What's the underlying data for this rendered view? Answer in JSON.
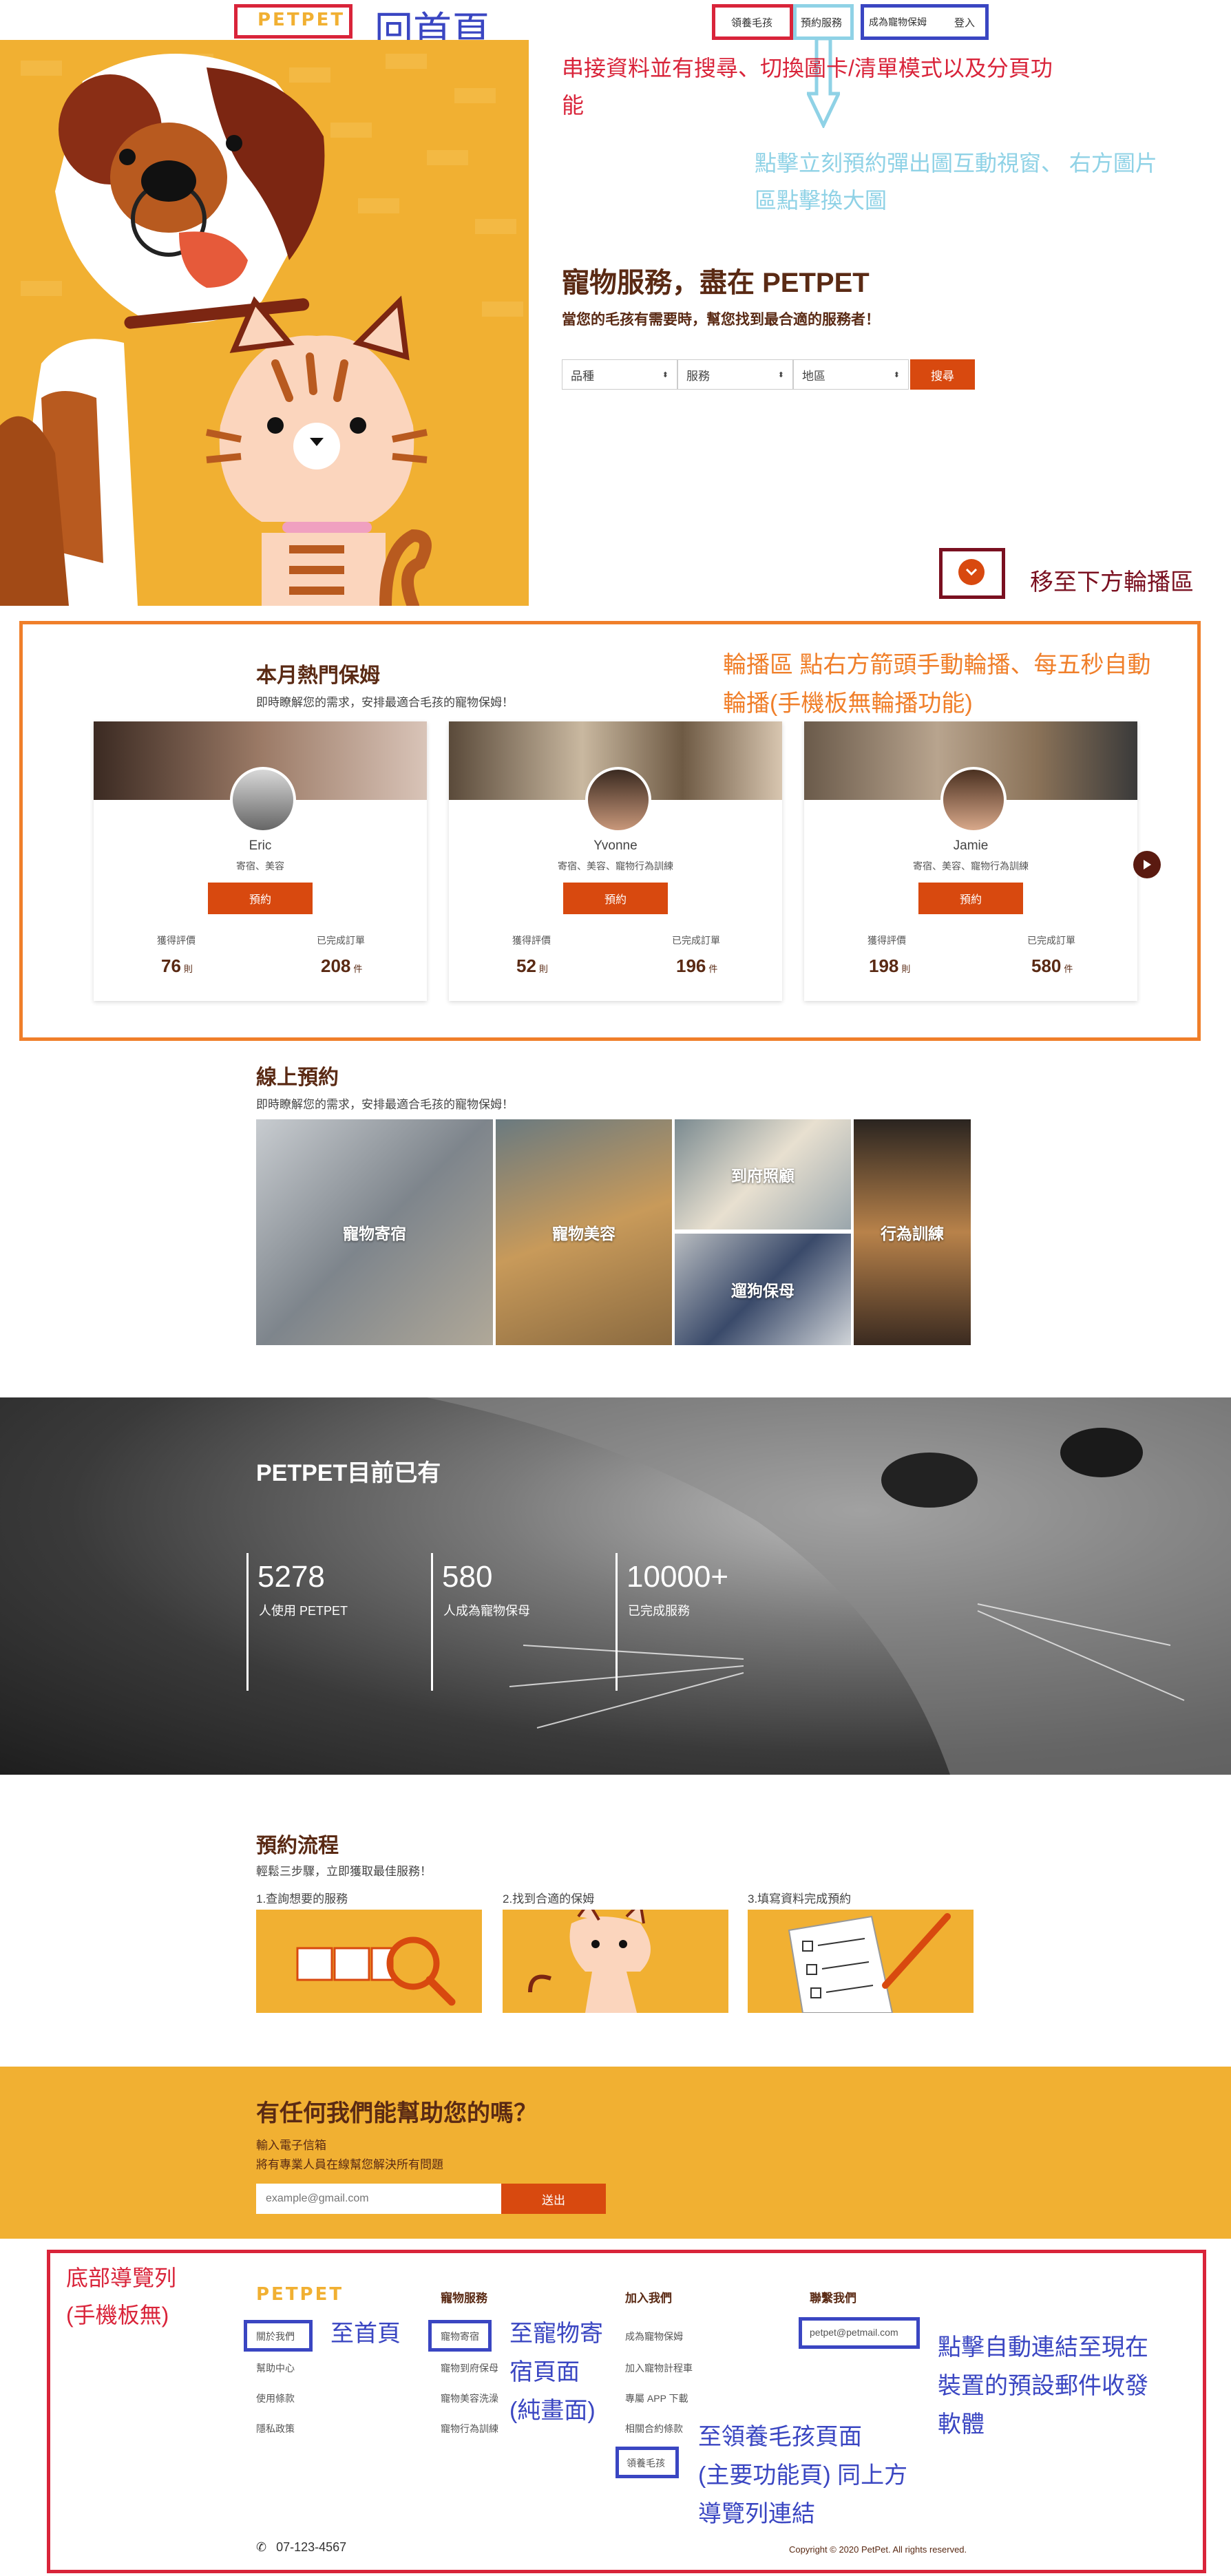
{
  "header": {
    "logo": "PETPET",
    "nav": [
      "領養毛孩",
      "預約服務",
      "成為寵物保姆",
      "登入"
    ]
  },
  "annotations": {
    "home": "回首頁",
    "search_feature": [
      "串接資料並有搜尋、切換圖卡/清單模式以及分頁功",
      "能"
    ],
    "booking_popup": [
      "點擊立刻預約彈出圖互動視窗、 右方圖片",
      "區點擊換大圖"
    ],
    "scroll_down": "移至下方輪播區",
    "carousel": [
      "輪播區 點右方箭頭手動輪播、每五秒自動",
      "輪播(手機板無輪播功能)"
    ],
    "footer_nav": [
      "底部導覽列",
      "(手機板無)"
    ],
    "to_home": "至首頁",
    "to_boarding": [
      "至寵物寄",
      "宿頁面",
      "(純畫面)"
    ],
    "to_adopt": [
      "至領養毛孩頁面",
      "(主要功能頁) 同上方",
      "導覽列連結"
    ],
    "email_auto": [
      "點擊自動連結至現在",
      "裝置的預設郵件收發",
      "軟體"
    ]
  },
  "hero": {
    "title": "寵物服務，盡在 PETPET",
    "subtitle": "當您的毛孩有需要時，幫您找到最合適的服務者！",
    "filters": [
      "品種",
      "服務",
      "地區"
    ],
    "search_button": "搜尋"
  },
  "popular": {
    "title": "本月熱門保姆",
    "subtitle": "即時瞭解您的需求，安排最適合毛孩的寵物保姆！",
    "sitters": [
      {
        "name": "Eric",
        "tags": "寄宿、美容",
        "button": "預約",
        "rating_label": "獲得評價",
        "rating": "76",
        "rating_unit": "則",
        "orders_label": "已完成訂單",
        "orders": "208",
        "orders_unit": "件"
      },
      {
        "name": "Yvonne",
        "tags": "寄宿、美容、寵物行為訓練",
        "button": "預約",
        "rating_label": "獲得評價",
        "rating": "52",
        "rating_unit": "則",
        "orders_label": "已完成訂單",
        "orders": "196",
        "orders_unit": "件"
      },
      {
        "name": "Jamie",
        "tags": "寄宿、美容、寵物行為訓練",
        "button": "預約",
        "rating_label": "獲得評價",
        "rating": "198",
        "rating_unit": "則",
        "orders_label": "已完成訂單",
        "orders": "580",
        "orders_unit": "件"
      }
    ]
  },
  "booking": {
    "title": "線上預約",
    "subtitle": "即時瞭解您的需求，安排最適合毛孩的寵物保姆！",
    "tiles": [
      "寵物寄宿",
      "寵物美容",
      "到府照顧",
      "遛狗保母",
      "行為訓練"
    ]
  },
  "stats": {
    "title": "PETPET目前已有",
    "items": [
      {
        "num": "5278",
        "label": "人使用 PETPET"
      },
      {
        "num": "580",
        "label": "人成為寵物保母"
      },
      {
        "num": "10000+",
        "label": "已完成服務"
      }
    ]
  },
  "process": {
    "title": "預約流程",
    "subtitle": "輕鬆三步驟，立即獲取最佳服務！",
    "steps": [
      "1.查詢想要的服務",
      "2.找到合適的保姆",
      "3.填寫資料完成預約"
    ]
  },
  "help": {
    "title": "有任何我們能幫助您的嗎？",
    "desc1": "輸入電子信箱",
    "desc2": "將有專業人員在線幫您解決所有問題",
    "placeholder": "example@gmail.com",
    "button": "送出"
  },
  "footer": {
    "logo": "PETPET",
    "col1": [
      "關於我們",
      "幫助中心",
      "使用條款",
      "隱私政策"
    ],
    "col2_title": "寵物服務",
    "col2": [
      "寵物寄宿",
      "寵物到府保母",
      "寵物美容洗澡",
      "寵物行為訓練"
    ],
    "col3_title": "加入我們",
    "col3": [
      "成為寵物保姆",
      "加入寵物計程車",
      "專屬 APP 下載",
      "相關合約條款",
      "領養毛孩"
    ],
    "col4_title": "聯繫我們",
    "email": "petpet@petmail.com",
    "phone": "07-123-4567",
    "copyright": "Copyright © 2020 PetPet. All rights reserved."
  },
  "colors": {
    "brand": "#f1b032",
    "accent": "#d8490f",
    "brown": "#5a2a14",
    "anno_red": "#d9243a",
    "anno_blue": "#3a46c2"
  }
}
